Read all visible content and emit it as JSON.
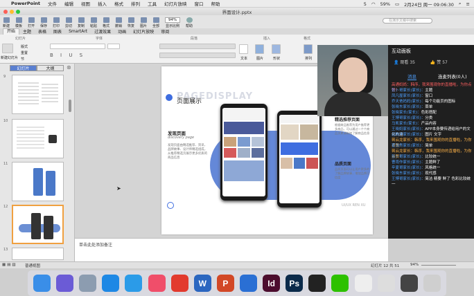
{
  "menubar": {
    "items": [
      "PowerPoint",
      "文件",
      "编辑",
      "视图",
      "插入",
      "格式",
      "排列",
      "工具",
      "幻灯片放映",
      "窗口",
      "帮助"
    ],
    "right": {
      "badge": "5",
      "battery": "59%",
      "datetime": "2月24日 周一  09:06:30"
    }
  },
  "window": {
    "title": "界面设计.pptx"
  },
  "quickbar": {
    "items": [
      "新建",
      "模板",
      "打开",
      "保存",
      "打印",
      "剪切",
      "复制",
      "粘贴",
      "格式",
      "撤销",
      "恢复",
      "图片",
      "全部",
      "显示比例",
      "帮助"
    ],
    "zoom": "94%",
    "search_placeholder": "在演示文稿中搜索"
  },
  "ribbon_tabs": [
    "开始",
    "主题",
    "表格",
    "图表",
    "SmartArt",
    "过渡效果",
    "动画",
    "幻灯片放映",
    "审阅"
  ],
  "ribbon": {
    "groups": [
      "幻灯片",
      "字体",
      "段落",
      "插入",
      "格式",
      "快速样式"
    ],
    "new_slide": "新建幻灯片",
    "layout": "版式",
    "reset": "重置",
    "section": "节",
    "labels": {
      "text": "文本",
      "image": "图片",
      "shape": "形状",
      "arrange": "排列"
    }
  },
  "leftpanel": {
    "tabs": [
      "幻灯片",
      "大纲"
    ],
    "slide_numbers": [
      "9",
      "10",
      "11",
      "12",
      "13"
    ]
  },
  "slide": {
    "title": "页面展示",
    "watermark": "PAGEDISPLAY",
    "left_heading": "发现页面",
    "left_sub": "discovery page",
    "left_body": "发现页面由精选推荐、资讯、品牌故事、设计师精选组成，从推荐精选页展示更多优质的商品信息",
    "right_heading1": "精选推荐页面",
    "right_body1": "根据商品推荐为用户推荐更多商品，可以通过一个个商品页更清晰地了解商品信息",
    "right_heading2": "品质页面",
    "right_body2": "品质页面可以让用户更多的了解品牌故事，增加品牌可信度",
    "footer": "UI/UX REN XU"
  },
  "notes": {
    "placeholder": "单击此处添加备注"
  },
  "status": {
    "view": "普通视图",
    "slide": "幻灯片 12 共 51",
    "zoom": "94%"
  },
  "panel": {
    "title": "互动面板",
    "viewers": "观看 35",
    "likes": "赞 57",
    "tabs": [
      "消息",
      "连麦列表(0人)"
    ],
    "messages": [
      {
        "who": "高通妈妈：韩序，我来围观你的直播啦，为你点赞！",
        "c": "cr"
      },
      {
        "who": "张卜哥家长(家长)：",
        "text": "主题"
      },
      {
        "who": "凤凡屋家长(家长)：",
        "text": "窗口"
      },
      {
        "who": "乔天爸妈妈(家长)：",
        "text": "每个功能页的图标"
      },
      {
        "who": "张晓东家长(家长)：",
        "text": "菜单"
      },
      {
        "who": "张晓家长(家长)：",
        "text": "色彩搭配"
      },
      {
        "who": "王博哥家长(家长)：",
        "text": "分类"
      },
      {
        "who": "马凯家长(家长)：",
        "text": "产品内容"
      },
      {
        "who": "王晓妈家长(家长)：",
        "text": "APP本身要传递给用户的文化内涵"
      },
      {
        "who": "吕秋洋家长(家长)：",
        "text": "图片  文字"
      },
      {
        "who": "蒋云龙家长：韩序，我来围观你的直播啦，为你点赞！",
        "c": "co"
      },
      {
        "who": "翟浩然家长(家长)：",
        "text": "简单"
      },
      {
        "who": "蒋云龙家长：韩序，我来围观你的直播啦，为你点赞！",
        "c": "co"
      },
      {
        "who": "张卜哥家长(家长)：",
        "text": "比较统一"
      },
      {
        "who": "曹雨作家长(家长)：",
        "text": "主题鲜了"
      },
      {
        "who": "辛夏哥家长(家长)：",
        "text": "风格统一"
      },
      {
        "who": "张晓东家长(家长)：",
        "text": "现代感"
      },
      {
        "who": "王博哥家长(家长)：",
        "text": "简洁  精要  鲜了  色彩比较统一"
      }
    ]
  },
  "dock": {
    "apps": [
      {
        "name": "Finder",
        "bg": "#3a8ee8",
        "g": ""
      },
      {
        "name": "Siri",
        "bg": "#6b5bd6",
        "g": ""
      },
      {
        "name": "Launchpad",
        "bg": "#8c9cb0",
        "g": ""
      },
      {
        "name": "App Store",
        "bg": "#1e88e5",
        "g": ""
      },
      {
        "name": "Safari",
        "bg": "#2b9be8",
        "g": ""
      },
      {
        "name": "Music",
        "bg": "#f04e6a",
        "g": ""
      },
      {
        "name": "NetEase Music",
        "bg": "#e23a2e",
        "g": ""
      },
      {
        "name": "Word",
        "bg": "#2b66c0",
        "g": "W"
      },
      {
        "name": "PowerPoint",
        "bg": "#d24726",
        "g": "P"
      },
      {
        "name": "Bird",
        "bg": "#2a6fd4",
        "g": ""
      },
      {
        "name": "InDesign",
        "bg": "#4c0d2e",
        "g": "Id"
      },
      {
        "name": "Photoshop",
        "bg": "#0b2a4a",
        "g": "Ps"
      },
      {
        "name": "QQ",
        "bg": "#222",
        "g": ""
      },
      {
        "name": "WeChat",
        "bg": "#2dc100",
        "g": ""
      },
      {
        "name": "Doc1",
        "bg": "#eee",
        "g": ""
      },
      {
        "name": "Doc2",
        "bg": "#ddd",
        "g": ""
      },
      {
        "name": "Screen",
        "bg": "#444",
        "g": ""
      },
      {
        "name": "Trash",
        "bg": "#cfcfcf",
        "g": ""
      }
    ]
  }
}
